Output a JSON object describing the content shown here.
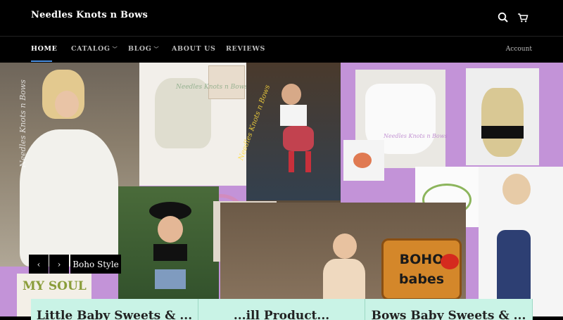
{
  "header": {
    "brand": "Needles Knots n Bows",
    "search_icon": "search-icon",
    "cart_icon": "cart-icon"
  },
  "nav": {
    "items": [
      {
        "label": "HOME",
        "active": true,
        "dropdown": false
      },
      {
        "label": "CATALOG",
        "active": false,
        "dropdown": true
      },
      {
        "label": "BLOG",
        "active": false,
        "dropdown": true
      },
      {
        "label": "ABOUT US",
        "active": false,
        "dropdown": false
      },
      {
        "label": "REVIEWS",
        "active": false,
        "dropdown": false
      }
    ],
    "account": "Account",
    "active_color": "#4a8fe0"
  },
  "hero": {
    "background": "#c393d8",
    "watermarks": {
      "wm1": "Needles Knots n Bows",
      "wm2": "Needles Knots n Bows",
      "wm3": "Needles Knots n Bows",
      "wm4": "Needles Knots n Bows"
    },
    "sign": {
      "line1": "BOHO",
      "line2": "babes"
    },
    "small_sign": "MY SOUL"
  },
  "slideshow": {
    "prev_icon": "‹",
    "next_icon": "›",
    "label": "Boho Style"
  },
  "promos": [
    {
      "text": "Little Baby Sweets & ..."
    },
    {
      "text": "...ill Product..."
    },
    {
      "text": "Bows Baby Sweets & ..."
    }
  ]
}
